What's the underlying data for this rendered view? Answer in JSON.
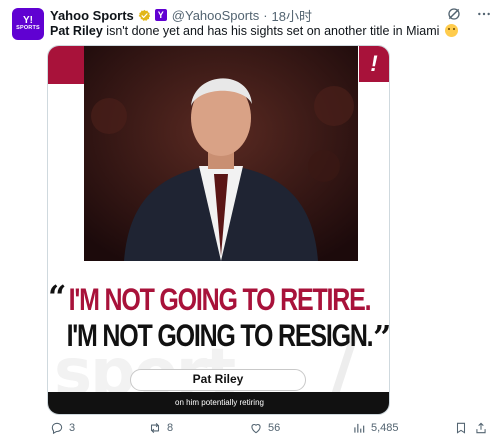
{
  "account": {
    "name": "Yahoo Sports",
    "handle": "@YahooSports",
    "separator": "·",
    "time": "18小时",
    "affiliate_glyph": "Y",
    "avatar_line1": "Y!",
    "avatar_line2": "SPORTS",
    "brand_color": "#6001d2",
    "verified_color": "#e2b719"
  },
  "tweet": {
    "bold_name": "Pat Riley",
    "text": " isn't done yet and has his sights set on another title in Miami",
    "emoji": "face-emoji"
  },
  "card": {
    "badge_glyph": "!",
    "quote_open": "“",
    "quote_close": "”",
    "line1": "I'M NOT GOING TO RETIRE.",
    "line2": "I'M NOT GOING TO RESIGN.",
    "speaker": "Pat Riley",
    "caption": "on him potentially retiring",
    "watermark": "sport",
    "accent_color": "#a8123a"
  },
  "actions": {
    "replies": "3",
    "reposts": "8",
    "likes": "56",
    "views": "5,485"
  },
  "icons": {
    "header": [
      "grok-icon",
      "more-icon"
    ],
    "actions": [
      "reply-icon",
      "repost-icon",
      "like-icon",
      "views-icon",
      "bookmark-icon",
      "share-icon"
    ]
  }
}
